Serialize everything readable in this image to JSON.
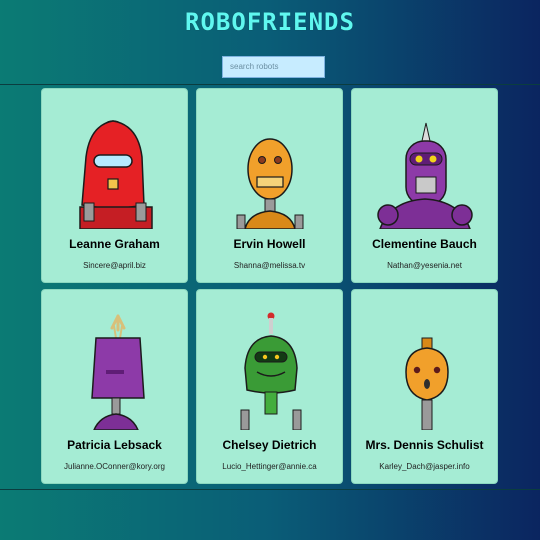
{
  "app": {
    "title": "ROBOFRIENDS"
  },
  "search": {
    "placeholder": "search robots",
    "value": ""
  },
  "robots": [
    {
      "name": "Leanne Graham",
      "email": "Sincere@april.biz"
    },
    {
      "name": "Ervin Howell",
      "email": "Shanna@melissa.tv"
    },
    {
      "name": "Clementine Bauch",
      "email": "Nathan@yesenia.net"
    },
    {
      "name": "Patricia Lebsack",
      "email": "Julianne.OConner@kory.org"
    },
    {
      "name": "Chelsey Dietrich",
      "email": "Lucio_Hettinger@annie.ca"
    },
    {
      "name": "Mrs. Dennis Schulist",
      "email": "Karley_Dach@jasper.info"
    }
  ],
  "colors": {
    "title": "#5ff7f0",
    "card": "#a5ecd4",
    "search": "#c7ecff"
  }
}
